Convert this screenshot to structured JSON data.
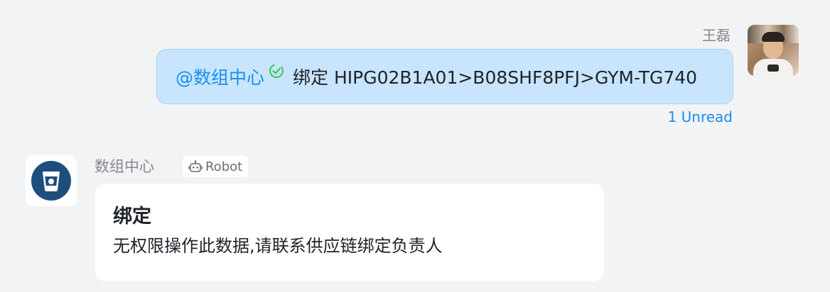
{
  "outgoing": {
    "sender_name": "王磊",
    "mention": "@数组中心",
    "message": "绑定 HIPG02B1A01>B08SHF8PFJ>GYM-TG740",
    "read_status": "1 Unread",
    "mention_status_icon": "check-circle-icon"
  },
  "incoming": {
    "sender_name": "数组中心",
    "tag_label": "Robot",
    "tag_icon": "robot-icon",
    "card_title": "绑定",
    "card_body": "无权限操作此数据,请联系供应链绑定负责人"
  },
  "colors": {
    "background": "#f2f3f5",
    "outgoing_bubble": "#c8e5fd",
    "accent": "#1a8ef0",
    "check": "#34c759",
    "bot_avatar": "#1e4e7d"
  }
}
